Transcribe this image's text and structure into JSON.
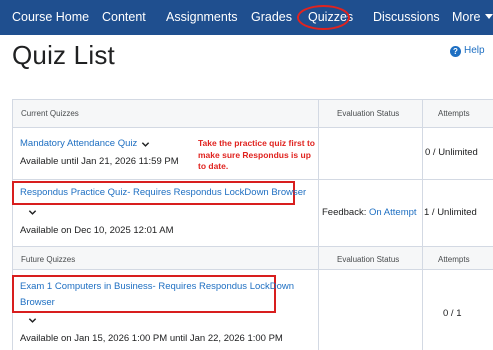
{
  "nav": {
    "items": [
      "Course Home",
      "Content",
      "Assignments",
      "Grades",
      "Quizzes",
      "Discussions",
      "More"
    ],
    "active": "Quizzes",
    "highlight_color": "#e0231f",
    "bar_color": "#1f4f8f"
  },
  "page": {
    "title": "Quiz List",
    "help_label": "Help",
    "help_icon": "help-circle-icon"
  },
  "table": {
    "headers": {
      "current": "Current Quizzes",
      "evaluation_status": "Evaluation Status",
      "attempts": "Attempts",
      "future": "Future Quizzes"
    },
    "current_quizzes": [
      {
        "name": "Mandatory Attendance Quiz",
        "availability": "Available until Jan 21, 2026 11:59 PM",
        "evaluation_status": "",
        "attempts": "0 / Unlimited"
      },
      {
        "name": "Respondus Practice Quiz- Requires Respondus LockDown Browser",
        "availability": "Available on Dec 10, 2025 12:01 AM",
        "evaluation_status_label": "Feedback:",
        "evaluation_status_link": "On Attempt",
        "attempts": "1 / Unlimited"
      }
    ],
    "future_quizzes": [
      {
        "name_line1": "Exam 1 Computers in Business- Requires Respondus LockDown",
        "name_line2": "Browser",
        "availability": "Available on Jan 15, 2026 1:00 PM until Jan 22, 2026 1:00 PM",
        "attempts": "0 / 1"
      }
    ]
  },
  "annotation": {
    "note": "Take the practice quiz first to make sure Respondus is up to date.",
    "color": "#e0231f"
  },
  "colors": {
    "link": "#1e6fc2",
    "header_bg": "#f6f7f8",
    "border": "#d3d9e3"
  }
}
